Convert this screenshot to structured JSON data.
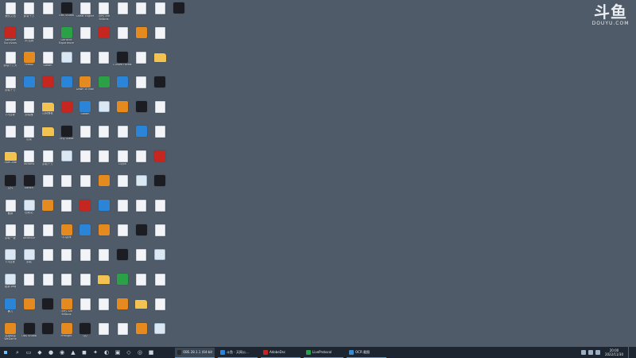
{
  "watermark": {
    "logo": "斗鱼",
    "sub": "DOUYU.COM"
  },
  "desktop_icons": [
    {
      "label": "我的文档",
      "kind": "doc"
    },
    {
      "label": "Vampire Survivors",
      "kind": "app-red"
    },
    {
      "label": "卸载千方天",
      "kind": "doc"
    },
    {
      "label": "卸载千方",
      "kind": "doc"
    },
    {
      "label": "(0)自我",
      "kind": "doc"
    },
    {
      "label": "",
      "kind": "doc"
    },
    {
      "label": "TrueCode",
      "kind": "folder"
    },
    {
      "label": "文件",
      "kind": "app-dark"
    },
    {
      "label": "截屏",
      "kind": "doc"
    },
    {
      "label": "卸载一键",
      "kind": "doc"
    },
    {
      "label": "(0)自我",
      "kind": "image"
    },
    {
      "label": "更新.png",
      "kind": "image"
    },
    {
      "label": "暴力",
      "kind": "app-blue"
    },
    {
      "label": "英雄联盟 WeGame",
      "kind": "app-orange"
    },
    {
      "label": "卸载千方",
      "kind": "doc"
    },
    {
      "label": "(0)自我",
      "kind": "doc"
    },
    {
      "label": "Firefox",
      "kind": "app-orange"
    },
    {
      "label": "",
      "kind": "app-blue"
    },
    {
      "label": "卸载器",
      "kind": "doc"
    },
    {
      "label": "设置",
      "kind": "doc"
    },
    {
      "label": "FarWest",
      "kind": "doc"
    },
    {
      "label": "Bench",
      "kind": "app-dark"
    },
    {
      "label": "回收站",
      "kind": "image"
    },
    {
      "label": "Attractor",
      "kind": "doc"
    },
    {
      "label": "卸载",
      "kind": "image"
    },
    {
      "label": "",
      "kind": "doc"
    },
    {
      "label": "",
      "kind": "app-orange"
    },
    {
      "label": "OBS Studio",
      "kind": "app-dark"
    },
    {
      "label": "",
      "kind": "doc"
    },
    {
      "label": "",
      "kind": "doc"
    },
    {
      "label": "Steam",
      "kind": "doc"
    },
    {
      "label": "",
      "kind": "app-red"
    },
    {
      "label": "控制面板",
      "kind": "folder"
    },
    {
      "label": "",
      "kind": "folder"
    },
    {
      "label": "卸载千方",
      "kind": "doc"
    },
    {
      "label": "",
      "kind": "doc"
    },
    {
      "label": "",
      "kind": "app-orange"
    },
    {
      "label": "",
      "kind": "doc"
    },
    {
      "label": "",
      "kind": "doc"
    },
    {
      "label": "",
      "kind": "doc"
    },
    {
      "label": "",
      "kind": "app-dark"
    },
    {
      "label": "",
      "kind": "app-dark"
    },
    {
      "label": "OBS Studio",
      "kind": "app-dark"
    },
    {
      "label": "GeForce Experience",
      "kind": "app-green"
    },
    {
      "label": "",
      "kind": "image"
    },
    {
      "label": "",
      "kind": "app-blue"
    },
    {
      "label": "",
      "kind": "app-red"
    },
    {
      "label": "Tiny Glade",
      "kind": "app-dark"
    },
    {
      "label": "",
      "kind": "image"
    },
    {
      "label": "",
      "kind": "doc"
    },
    {
      "label": "",
      "kind": "doc"
    },
    {
      "label": "QQ游戏",
      "kind": "app-orange"
    },
    {
      "label": "",
      "kind": "doc"
    },
    {
      "label": "",
      "kind": "doc"
    },
    {
      "label": "They Are Billions",
      "kind": "app-orange"
    },
    {
      "label": "Preflight",
      "kind": "app-orange"
    },
    {
      "label": "Cheat Engine",
      "kind": "doc"
    },
    {
      "label": "",
      "kind": "doc"
    },
    {
      "label": "",
      "kind": "doc"
    },
    {
      "label": "Dawn of Man",
      "kind": "app-orange"
    },
    {
      "label": "Steam",
      "kind": "app-blue"
    },
    {
      "label": "",
      "kind": "doc"
    },
    {
      "label": "",
      "kind": "doc"
    },
    {
      "label": "",
      "kind": "doc"
    },
    {
      "label": "",
      "kind": "app-red"
    },
    {
      "label": "",
      "kind": "app-blue"
    },
    {
      "label": "",
      "kind": "doc"
    },
    {
      "label": "",
      "kind": "doc"
    },
    {
      "label": "",
      "kind": "doc"
    },
    {
      "label": "QQ",
      "kind": "app-dark"
    },
    {
      "label": "They Are Billions",
      "kind": "doc"
    },
    {
      "label": "",
      "kind": "app-red"
    },
    {
      "label": "",
      "kind": "doc"
    },
    {
      "label": "",
      "kind": "app-green"
    },
    {
      "label": "",
      "kind": "image"
    },
    {
      "label": "",
      "kind": "doc"
    },
    {
      "label": "",
      "kind": "doc"
    },
    {
      "label": "",
      "kind": "app-orange"
    },
    {
      "label": "",
      "kind": "app-blue"
    },
    {
      "label": "",
      "kind": "app-orange"
    },
    {
      "label": "",
      "kind": "doc"
    },
    {
      "label": "",
      "kind": "folder"
    },
    {
      "label": "",
      "kind": "doc"
    },
    {
      "label": "",
      "kind": "doc"
    },
    {
      "label": "",
      "kind": "doc"
    },
    {
      "label": "",
      "kind": "doc"
    },
    {
      "label": "Cursed Forest",
      "kind": "app-dark"
    },
    {
      "label": "",
      "kind": "app-blue"
    },
    {
      "label": "",
      "kind": "app-orange"
    },
    {
      "label": "",
      "kind": "doc"
    },
    {
      "label": "Glyph",
      "kind": "doc"
    },
    {
      "label": "",
      "kind": "doc"
    },
    {
      "label": "",
      "kind": "doc"
    },
    {
      "label": "",
      "kind": "doc"
    },
    {
      "label": "",
      "kind": "app-dark"
    },
    {
      "label": "",
      "kind": "app-green"
    },
    {
      "label": "",
      "kind": "app-orange"
    },
    {
      "label": "",
      "kind": "doc"
    },
    {
      "label": "",
      "kind": "doc"
    },
    {
      "label": "",
      "kind": "app-orange"
    },
    {
      "label": "",
      "kind": "doc"
    },
    {
      "label": "",
      "kind": "doc"
    },
    {
      "label": "",
      "kind": "app-dark"
    },
    {
      "label": "",
      "kind": "app-blue"
    },
    {
      "label": "",
      "kind": "doc"
    },
    {
      "label": "",
      "kind": "image"
    },
    {
      "label": "",
      "kind": "doc"
    },
    {
      "label": "",
      "kind": "app-dark"
    },
    {
      "label": "",
      "kind": "doc"
    },
    {
      "label": "",
      "kind": "doc"
    },
    {
      "label": "",
      "kind": "folder"
    },
    {
      "label": "",
      "kind": "app-orange"
    },
    {
      "label": "",
      "kind": "doc"
    },
    {
      "label": "",
      "kind": "doc"
    },
    {
      "label": "",
      "kind": "folder"
    },
    {
      "label": "",
      "kind": "app-dark"
    },
    {
      "label": "",
      "kind": "doc"
    },
    {
      "label": "",
      "kind": "doc"
    },
    {
      "label": "",
      "kind": "app-red"
    },
    {
      "label": "",
      "kind": "app-dark"
    },
    {
      "label": "",
      "kind": "doc"
    },
    {
      "label": "",
      "kind": "doc"
    },
    {
      "label": "",
      "kind": "image"
    },
    {
      "label": "",
      "kind": "doc"
    },
    {
      "label": "",
      "kind": "doc"
    },
    {
      "label": "",
      "kind": "image"
    },
    {
      "label": "",
      "kind": "app-dark"
    }
  ],
  "taskbar": {
    "pins": [
      {
        "name": "search-icon",
        "glyph": "⌕"
      },
      {
        "name": "task-view-icon",
        "glyph": "▭"
      },
      {
        "name": "pin-app-1-icon",
        "glyph": "◆"
      },
      {
        "name": "pin-app-2-icon",
        "glyph": "●"
      },
      {
        "name": "pin-app-3-icon",
        "glyph": "◉"
      },
      {
        "name": "pin-app-4-icon",
        "glyph": "▲"
      },
      {
        "name": "pin-app-5-icon",
        "glyph": "◼"
      },
      {
        "name": "pin-app-6-icon",
        "glyph": "✦"
      },
      {
        "name": "pin-app-7-icon",
        "glyph": "◐"
      },
      {
        "name": "pin-app-8-icon",
        "glyph": "▣"
      },
      {
        "name": "pin-app-9-icon",
        "glyph": "◇"
      },
      {
        "name": "pin-app-10-icon",
        "glyph": "◎"
      },
      {
        "name": "pin-app-11-icon",
        "glyph": "■"
      }
    ],
    "tasks": [
      {
        "label": "OBS 28.1.1 (64-bit, ...",
        "color": "#2b2b2b",
        "active": true
      },
      {
        "label": "斗鱼 - 天网公...",
        "color": "#2a84d8",
        "active": false
      },
      {
        "label": "AdobeDsc",
        "color": "#c5261f",
        "active": false
      },
      {
        "label": "LiveProtocol",
        "color": "#2aa147",
        "active": false
      },
      {
        "label": "OCR 截图",
        "color": "#3a8ad0",
        "active": false
      }
    ],
    "clock": {
      "time": "20:00",
      "date": "2022/11/30"
    }
  }
}
